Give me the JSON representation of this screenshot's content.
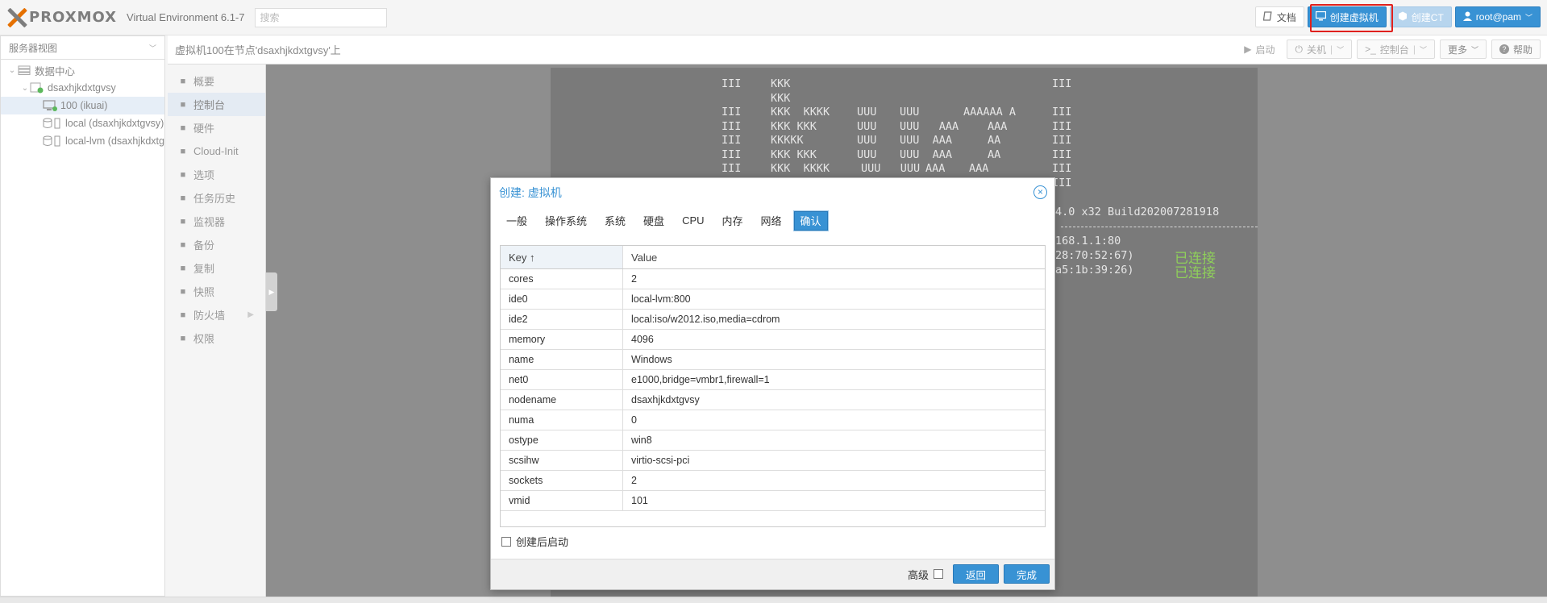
{
  "app": {
    "brand": "PROXMOX",
    "version": "Virtual Environment 6.1-7",
    "search_placeholder": "搜索"
  },
  "header_buttons": {
    "docs": "文档",
    "create_vm": "创建虚拟机",
    "create_ct": "创建CT",
    "user": "root@pam"
  },
  "tree": {
    "view_select": "服务器视图",
    "datacenter": "数据中心",
    "node": "dsaxhjkdxtgvsy",
    "vm": "100 (ikuai)",
    "storage_local": "local (dsaxhjkdxtgvsy)",
    "storage_lvm": "local-lvm (dsaxhjkdxtgvsy)"
  },
  "crumb": {
    "title": "虚拟机100在节点'dsaxhjkdxtgvsy'上",
    "start": "启动",
    "shutdown": "关机",
    "console": "控制台",
    "more": "更多",
    "help": "帮助"
  },
  "vm_nav": [
    {
      "icon": "summary-icon",
      "label": "概要",
      "active": false,
      "arrow": false
    },
    {
      "icon": "console-icon",
      "label": "控制台",
      "active": true,
      "arrow": false
    },
    {
      "icon": "hardware-icon",
      "label": "硬件",
      "active": false,
      "arrow": false
    },
    {
      "icon": "cloud-icon",
      "label": "Cloud-Init",
      "active": false,
      "arrow": false
    },
    {
      "icon": "gear-icon",
      "label": "选项",
      "active": false,
      "arrow": false
    },
    {
      "icon": "list-icon",
      "label": "任务历史",
      "active": false,
      "arrow": false
    },
    {
      "icon": "eye-icon",
      "label": "监视器",
      "active": false,
      "arrow": false
    },
    {
      "icon": "floppy-icon",
      "label": "备份",
      "active": false,
      "arrow": false
    },
    {
      "icon": "replicate-icon",
      "label": "复制",
      "active": false,
      "arrow": false
    },
    {
      "icon": "history-icon",
      "label": "快照",
      "active": false,
      "arrow": false
    },
    {
      "icon": "shield-icon",
      "label": "防火墙",
      "active": false,
      "arrow": true
    },
    {
      "icon": "unlock-icon",
      "label": "权限",
      "active": false,
      "arrow": false
    }
  ],
  "console": {
    "banner": [
      [
        "III",
        "KKK",
        "",
        "",
        "",
        "III"
      ],
      [
        "",
        "KKK",
        "",
        "",
        "",
        ""
      ],
      [
        "III",
        "KKK  KKKK",
        "UUU",
        "UUU",
        "AAAAAA A",
        "III"
      ],
      [
        "III",
        "KKK KKK",
        "UUU",
        "UUU   AAA",
        "AAA",
        "III"
      ],
      [
        "III",
        "KKKKK",
        "UUU",
        "UUU  AAA",
        "AA",
        "III"
      ],
      [
        "III",
        "KKK KKK",
        "UUU",
        "UUU  AAA",
        "AA",
        "III"
      ],
      [
        "III",
        "KKK  KKKK",
        "UUU   UUU",
        "AAA",
        "AAA",
        "III"
      ],
      [
        "",
        "",
        "",
        "",
        "",
        "III"
      ]
    ],
    "build": "4.0 x32 Build202007281918",
    "ip": "168.1.1:80",
    "mac1": "28:70:52:67)",
    "mac2": "a5:1b:39:26)",
    "status1": "已连接",
    "status2": "已连接"
  },
  "dialog": {
    "title": "创建: 虚拟机",
    "tabs": [
      "一般",
      "操作系统",
      "系统",
      "硬盘",
      "CPU",
      "内存",
      "网络",
      "确认"
    ],
    "active_tab": 7,
    "key_header": "Key ↑",
    "value_header": "Value",
    "rows": [
      {
        "key": "cores",
        "value": "2"
      },
      {
        "key": "ide0",
        "value": "local-lvm:800"
      },
      {
        "key": "ide2",
        "value": "local:iso/w2012.iso,media=cdrom"
      },
      {
        "key": "memory",
        "value": "4096"
      },
      {
        "key": "name",
        "value": "Windows"
      },
      {
        "key": "net0",
        "value": "e1000,bridge=vmbr1,firewall=1"
      },
      {
        "key": "nodename",
        "value": "dsaxhjkdxtgvsy"
      },
      {
        "key": "numa",
        "value": "0"
      },
      {
        "key": "ostype",
        "value": "win8"
      },
      {
        "key": "scsihw",
        "value": "virtio-scsi-pci"
      },
      {
        "key": "sockets",
        "value": "2"
      },
      {
        "key": "vmid",
        "value": "101"
      }
    ],
    "start_after": "创建后启动",
    "advanced": "高级",
    "back": "返回",
    "finish": "完成"
  }
}
